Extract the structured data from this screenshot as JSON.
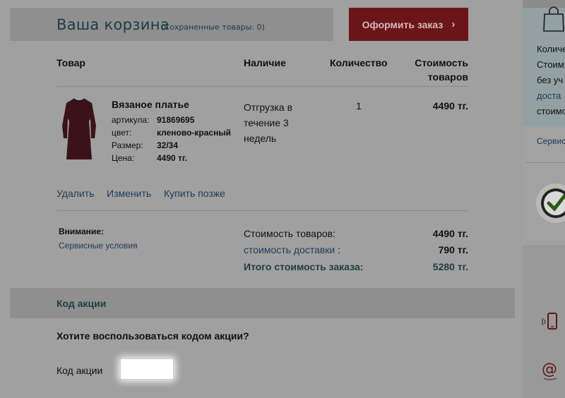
{
  "cart": {
    "title": "Ваша корзина",
    "saved_items": "(Сохраненные товары: 0)",
    "checkout_label": "Оформить заказ",
    "checkout_arrow": "›"
  },
  "table": {
    "col_product": "Товар",
    "col_availability": "Наличие",
    "col_quantity": "Количество",
    "col_cost_line1": "Стоимость",
    "col_cost_line2": "товаров"
  },
  "item": {
    "name": "Вязаное платье",
    "fields": [
      {
        "label": "артикула:",
        "value": "91869695"
      },
      {
        "label": "цвет:",
        "value": "кленово-красный"
      },
      {
        "label": "Размер:",
        "value": "32/34"
      },
      {
        "label": "Цена:",
        "value": "4490 тг."
      }
    ],
    "availability_lines": [
      "Отгрузка в",
      "течение 3",
      "недель"
    ],
    "quantity": "1",
    "price": "4490 тг.",
    "actions": {
      "delete": "Удалить",
      "edit": "Изменить",
      "buy_later": "Купить позже"
    }
  },
  "summary": {
    "attention": "Внимание:",
    "service_terms": "Сервисные условия",
    "items_cost_label": "Стоимость товаров:",
    "items_cost_value": "4490 тг.",
    "delivery_link": "стоимость доставки",
    "delivery_colon": ":",
    "delivery_value": "790 тг.",
    "total_label": "Итого стоимость заказа:",
    "total_value": "5280 тг."
  },
  "promo": {
    "title": "Код акции",
    "question": "Хотите воспользоваться кодом акции?",
    "field_label": "Код акции",
    "field_value": ""
  },
  "sidebar": {
    "lines": [
      "Количе",
      "Стоим",
      "без уч"
    ],
    "link1": "доста",
    "line4": "стоимо",
    "service_link": "Сервис"
  },
  "colors": {
    "checkout_button": "#6b1519",
    "link": "#1e3b57",
    "total": "#1f3e3e"
  },
  "icons": [
    "shopping-bag-icon",
    "trust-badge-icon",
    "phone-icon",
    "at-sign-icon"
  ]
}
